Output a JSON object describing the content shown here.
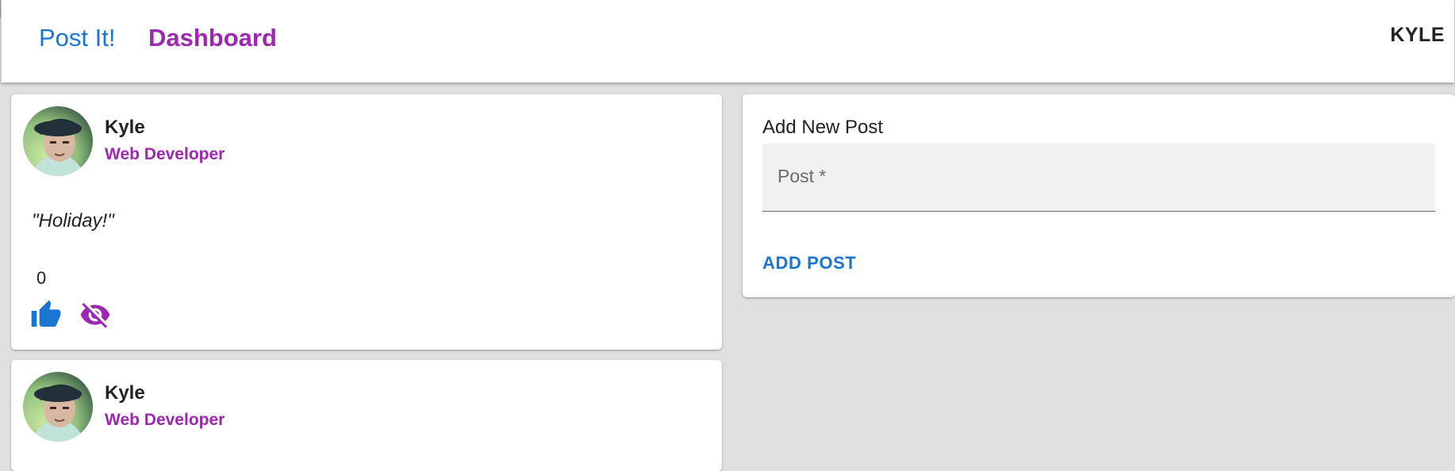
{
  "header": {
    "brand": "Post It!",
    "nav_dashboard": "Dashboard",
    "user": "KYLE"
  },
  "posts": [
    {
      "author": "Kyle",
      "role": "Web Developer",
      "text": "\"Holiday!\"",
      "likes": "0",
      "icons": [
        "thumbs-up-icon",
        "visibility-off-icon"
      ]
    },
    {
      "author": "Kyle",
      "role": "Web Developer"
    }
  ],
  "add_post": {
    "title": "Add New Post",
    "field_label": "Post *",
    "button": "ADD POST"
  },
  "colors": {
    "primary": "#1976d2",
    "secondary": "#9c27b0",
    "background": "#e0e0e0"
  }
}
